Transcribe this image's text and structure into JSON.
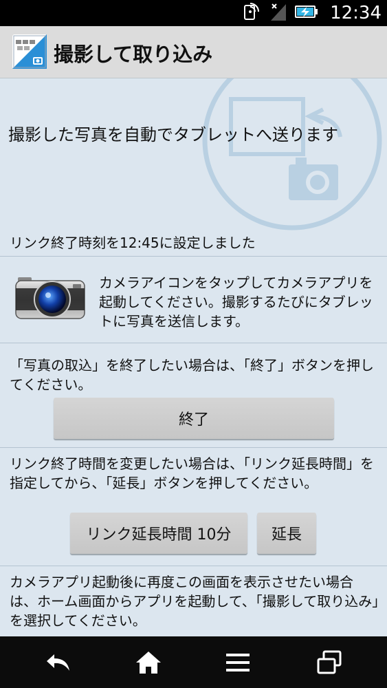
{
  "status_bar": {
    "time": "12:34",
    "icons": [
      "nfc-icon",
      "no-signal-icon",
      "battery-charging-icon"
    ]
  },
  "action_bar": {
    "title": "撮影して取り込み",
    "icon": "app-transfer-icon"
  },
  "main": {
    "headline": "撮影した写真を自動でタブレットへ送ります",
    "link_end_notice": "リンク終了時刻を12:45に設定しました",
    "camera_instruction": "カメラアイコンをタップしてカメラアプリを起動してください。撮影するたびにタブレットに写真を送信します。",
    "exit_instruction": "「写真の取込」を終了したい場合は、「終了」ボタンを押してください。",
    "exit_button_label": "終了",
    "extend_instruction": "リンク終了時間を変更したい場合は、「リンク延長時間」を指定してから、「延長」ボタンを押してください。",
    "extend_time_label": "リンク延長時間 10分",
    "extend_button_label": "延長",
    "relaunch_instruction": "カメラアプリ起動後に再度この画面を表示させたい場合は、ホーム画面からアプリを起動して、「撮影して取り込み」を選択してください。"
  },
  "nav_bar": {
    "buttons": [
      "back-icon",
      "home-icon",
      "menu-icon",
      "recent-apps-icon"
    ]
  },
  "colors": {
    "content_bg": "#dce6ef",
    "divider": "#b4c3d0",
    "emblem": "#b9d0e2"
  }
}
